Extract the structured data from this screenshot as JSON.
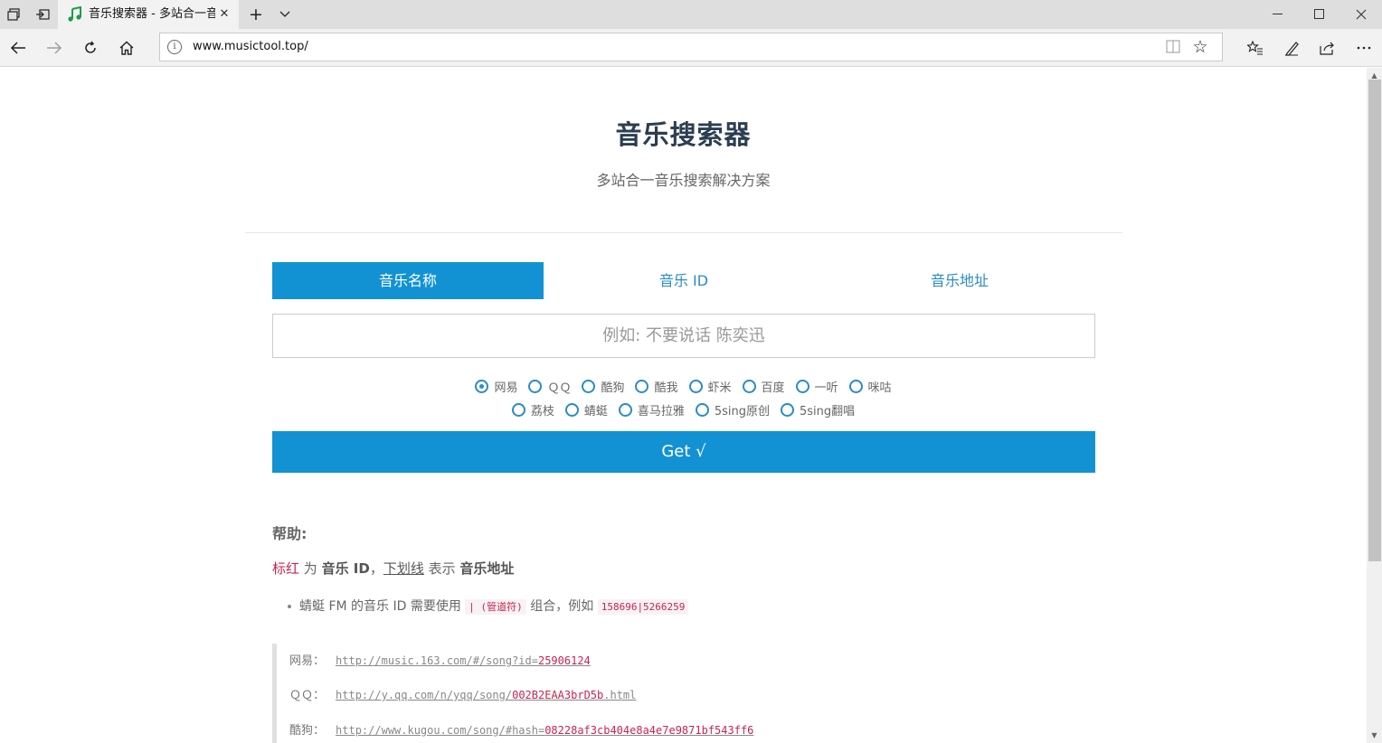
{
  "browser": {
    "tab_title": "音乐搜索器 - 多站合一音",
    "url": "www.musictool.top/"
  },
  "page": {
    "title": "音乐搜索器",
    "subtitle": "多站合一音乐搜索解决方案"
  },
  "mode_tabs": [
    {
      "label": "音乐名称",
      "active": true
    },
    {
      "label": "音乐 ID",
      "active": false
    },
    {
      "label": "音乐地址",
      "active": false
    }
  ],
  "search": {
    "placeholder": "例如: 不要说话 陈奕迅"
  },
  "sources_row1": [
    "网易",
    "ＱＱ",
    "酷狗",
    "酷我",
    "虾米",
    "百度",
    "一听",
    "咪咕"
  ],
  "sources_row2": [
    "荔枝",
    "蜻蜓",
    "喜马拉雅",
    "5sing原创",
    "5sing翻唱"
  ],
  "selected_source": "网易",
  "get_button": "Get √",
  "help": {
    "title": "帮助:",
    "legend": {
      "red": "标红",
      "is": " 为 ",
      "id": "音乐 ID",
      "comma": "，",
      "underline": "下划线",
      "means": " 表示 ",
      "addr": "音乐地址"
    },
    "note": {
      "prefix": "蜻蜓 FM 的音乐 ID 需要使用 ",
      "code1": "| (管道符)",
      "middle": " 组合，例如 ",
      "code2": "158696|5266259"
    },
    "examples": [
      {
        "site": "网易：",
        "url_base": "http://music.163.com/#/song?id=",
        "url_id": "25906124",
        "url_tail": ""
      },
      {
        "site": "ＱＱ：",
        "url_base": "http://y.qq.com/n/yqq/song/",
        "url_id": "002B2EAA3brD5b",
        "url_tail": ".html"
      },
      {
        "site": "酷狗：",
        "url_base": "http://www.kugou.com/song/#hash=",
        "url_id": "08228af3cb404e8a4e7e9871bf543ff6",
        "url_tail": ""
      }
    ]
  }
}
